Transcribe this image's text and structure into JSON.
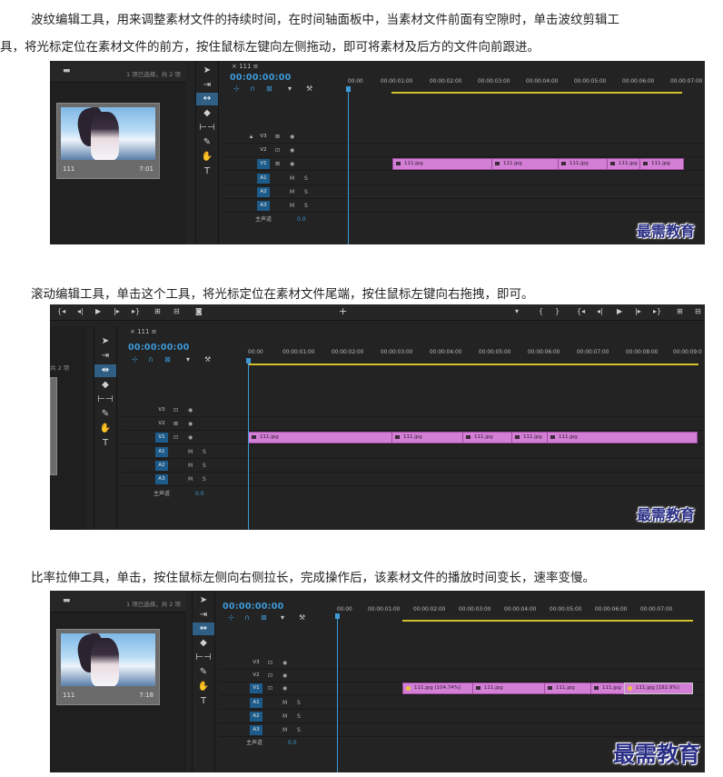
{
  "paragraphs": {
    "p1_line1": "波纹编辑工具，用来调整素材文件的持续时间，在时间轴面板中，当素材文件前面有空隙时，单击波纹剪辑工",
    "p1_line2": "具，将光标定位在素材文件的前方，按住鼠标左键向左侧拖动，即可将素材及后方的文件向前跟进。",
    "p2": "滚动编辑工具，单击这个工具，将光标定位在素材文件尾端，按住鼠标左键向右拖拽，即可。",
    "p3": "比率拉伸工具，单击，按住鼠标左侧向右侧拉长，完成操作后，该素材文件的播放时间变长，速率变慢。"
  },
  "watermark": "最需教育",
  "shot1": {
    "project_status": "1 项已选择，共 2 项",
    "thumb_name": "111",
    "thumb_duration": "7:01",
    "tab": "× 111 ≡",
    "timecode": "00:00:00:00",
    "ruler": [
      "00:00",
      "00:00:01:00",
      "00:00:02:00",
      "00:00:03:00",
      "00:00:04:00",
      "00:00:05:00",
      "00:00:06:00",
      "00:00:07:00"
    ],
    "master": "主声道",
    "master_val": "0.0",
    "clips": [
      "111.jpg",
      "111.jpg",
      "111.jpg",
      "111.jpg",
      "111.jpg"
    ]
  },
  "shot2": {
    "project_status": "共 2 项",
    "timecode": "00:00:00:00",
    "tab": "× 111 ≡",
    "ruler": [
      "00:00",
      "00:00:01:00",
      "00:00:02:00",
      "00:00:03:00",
      "00:00:04:00",
      "00:00:05:00",
      "00:00:06:00",
      "00:00:07:00",
      "00:00:08:00",
      "00:00:09:0"
    ],
    "master": "主声道",
    "master_val": "0.0",
    "clips": [
      "111.jpg",
      "111.jpg",
      "111.jpg",
      "111.jpg",
      "111.jpg"
    ]
  },
  "shot3": {
    "project_status": "1 项已选择，共 2 项",
    "thumb_name": "111",
    "thumb_duration": "7:18",
    "timecode": "00:00:00:00",
    "ruler": [
      "00:00",
      "00:00:01:00",
      "00:00:02:00",
      "00:00:03:00",
      "00:00:04:00",
      "00:00:05:00",
      "00:00:06:00",
      "00:00:07:00"
    ],
    "master": "主声道",
    "master_val": "0.0",
    "clips": [
      "111.jpg [104.74%]",
      "111.jpg",
      "111.jpg",
      "111.jpg",
      "111.jpg [192.9%]"
    ]
  },
  "tracks": {
    "video": [
      "V3",
      "V2",
      "V1"
    ],
    "audio": [
      "A1",
      "A2",
      "A3"
    ],
    "m": "M",
    "s": "S"
  },
  "colors": {
    "accent": "#3d9ad9",
    "clip": "#d47fd6",
    "workarea": "#d3c02a",
    "panel": "#232323"
  }
}
